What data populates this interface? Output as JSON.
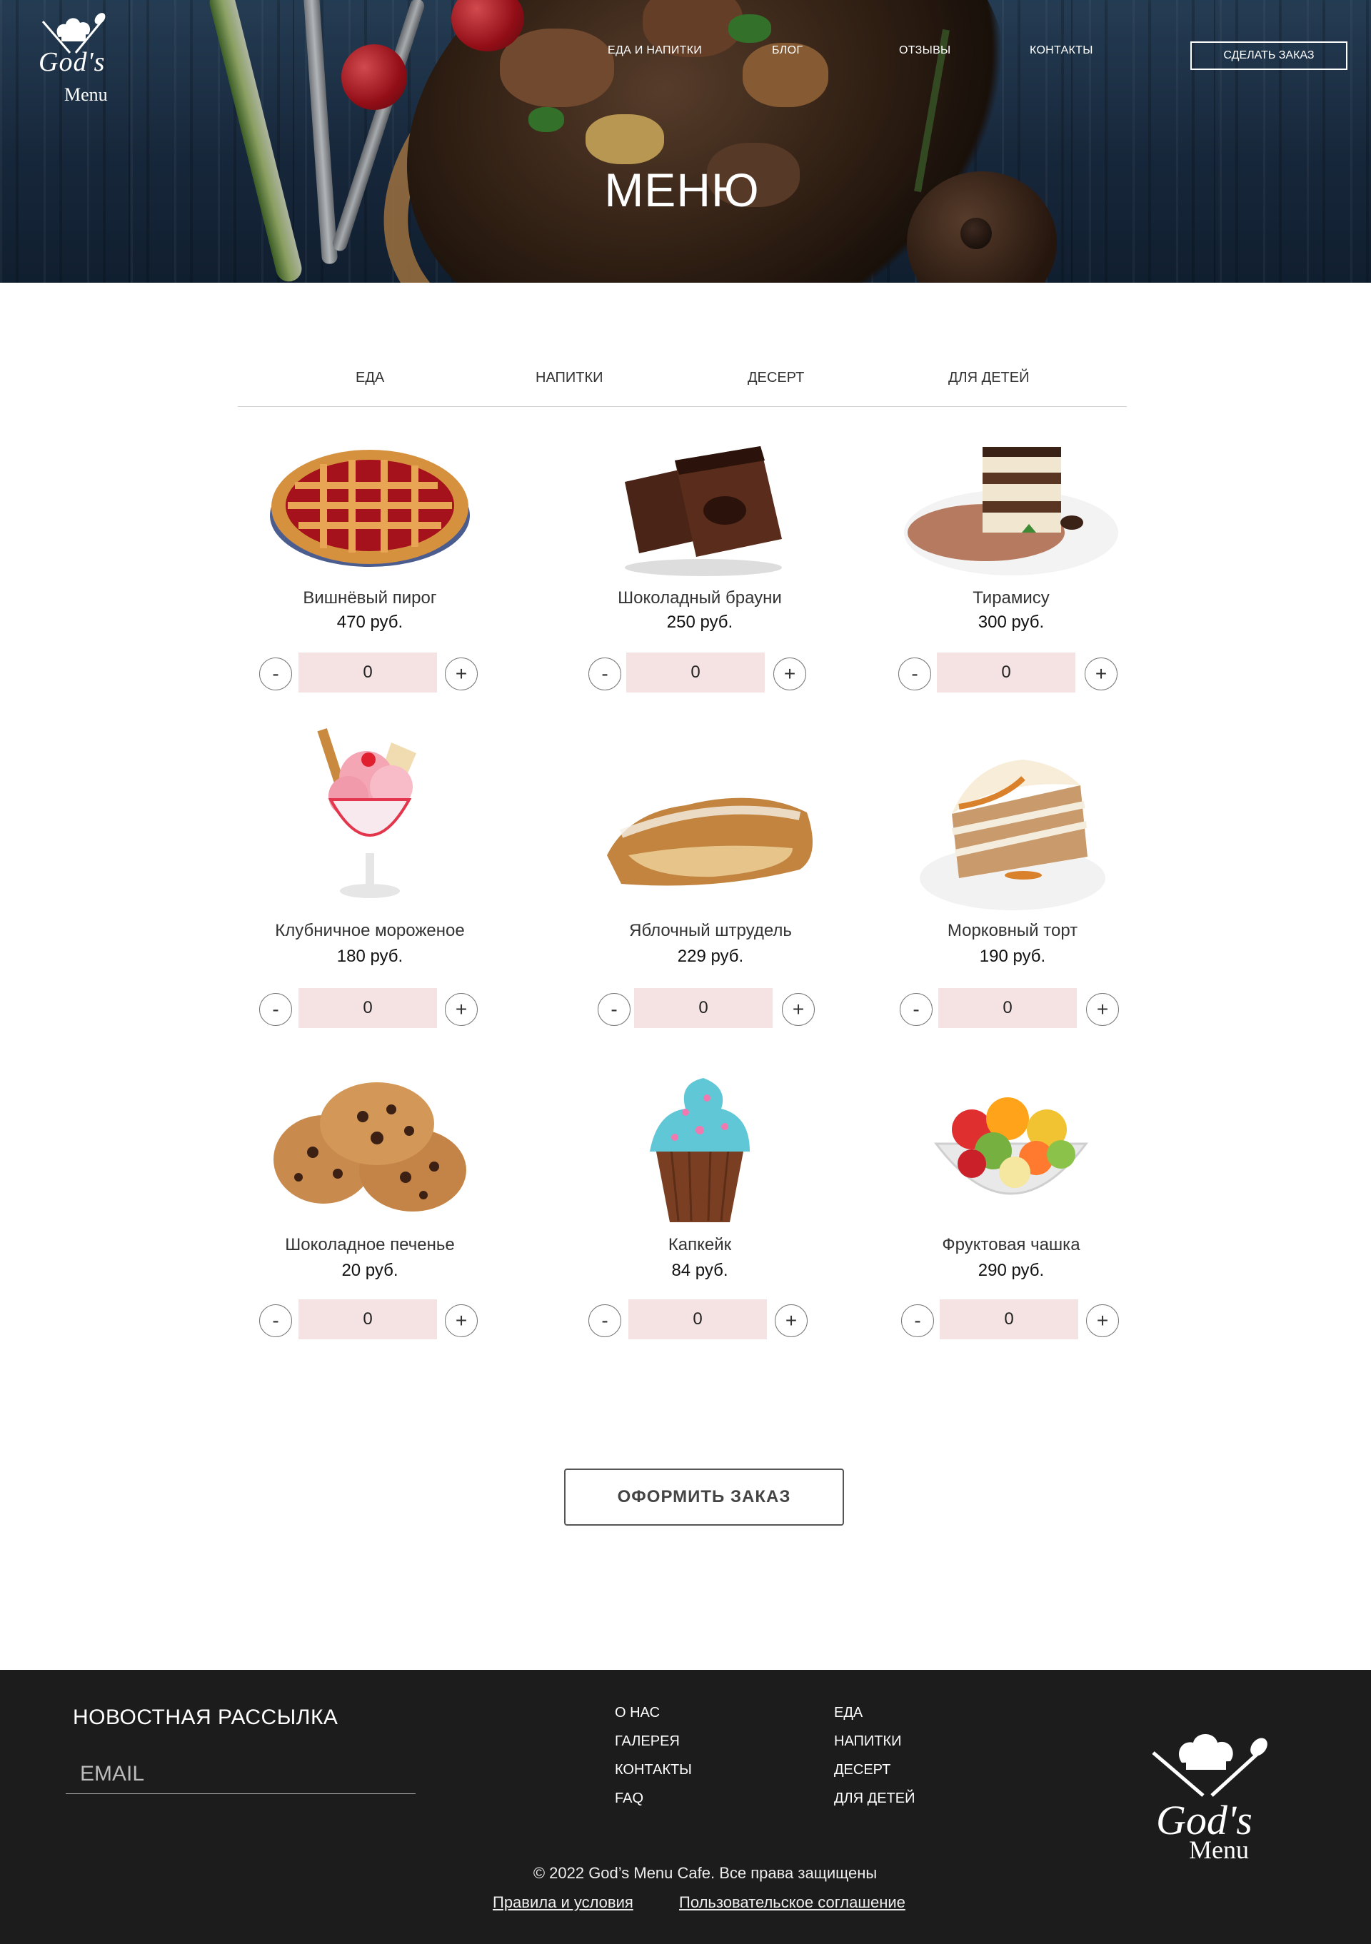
{
  "brand": {
    "line1": "God's",
    "line2": "Menu"
  },
  "nav": {
    "items": [
      "ЕДА И НАПИТКИ",
      "БЛОГ",
      "ОТЗЫВЫ",
      "КОНТАКТЫ"
    ],
    "cta": "СДЕЛАТЬ ЗАКАЗ"
  },
  "hero": {
    "title": "МЕНЮ"
  },
  "tabs": [
    "ЕДА",
    "НАПИТКИ",
    "ДЕСЕРТ",
    "ДЛЯ ДЕТЕЙ"
  ],
  "products": [
    {
      "name": "Вишнёвый пирог",
      "price": "470 руб.",
      "qty": "0",
      "icon": "cherry-pie"
    },
    {
      "name": "Шоколадный брауни",
      "price": "250 руб.",
      "qty": "0",
      "icon": "brownie"
    },
    {
      "name": "Тирамису",
      "price": "300 руб.",
      "qty": "0",
      "icon": "tiramisu"
    },
    {
      "name": "Клубничное мороженое",
      "price": "180 руб.",
      "qty": "0",
      "icon": "ice-cream"
    },
    {
      "name": "Яблочный штрудель",
      "price": "229 руб.",
      "qty": "0",
      "icon": "strudel"
    },
    {
      "name": "Морковный торт",
      "price": "190 руб.",
      "qty": "0",
      "icon": "carrot-cake"
    },
    {
      "name": "Шоколадное печенье",
      "price": "20 руб.",
      "qty": "0",
      "icon": "cookies"
    },
    {
      "name": "Капкейк",
      "price": "84 руб.",
      "qty": "0",
      "icon": "cupcake"
    },
    {
      "name": "Фруктовая чашка",
      "price": "290 руб.",
      "qty": "0",
      "icon": "fruit-bowl"
    }
  ],
  "stepper": {
    "minus": "-",
    "plus": "+"
  },
  "checkout": "ОФОРМИТЬ ЗАКАЗ",
  "footer": {
    "newsletter_title": "НОВОСТНАЯ РАССЫЛКА",
    "email_placeholder": "EMAIL",
    "links_col1": [
      "О НАС",
      "ГАЛЕРЕЯ",
      "КОНТАКТЫ",
      "FAQ"
    ],
    "links_col2": [
      "ЕДА",
      "НАПИТКИ",
      "ДЕСЕРТ",
      "ДЛЯ ДЕТЕЙ"
    ],
    "copyright": "© 2022 God’s Menu Cafe. Все права защищены",
    "terms": "Правила и условия",
    "agreement": "Пользовательское соглашение"
  }
}
